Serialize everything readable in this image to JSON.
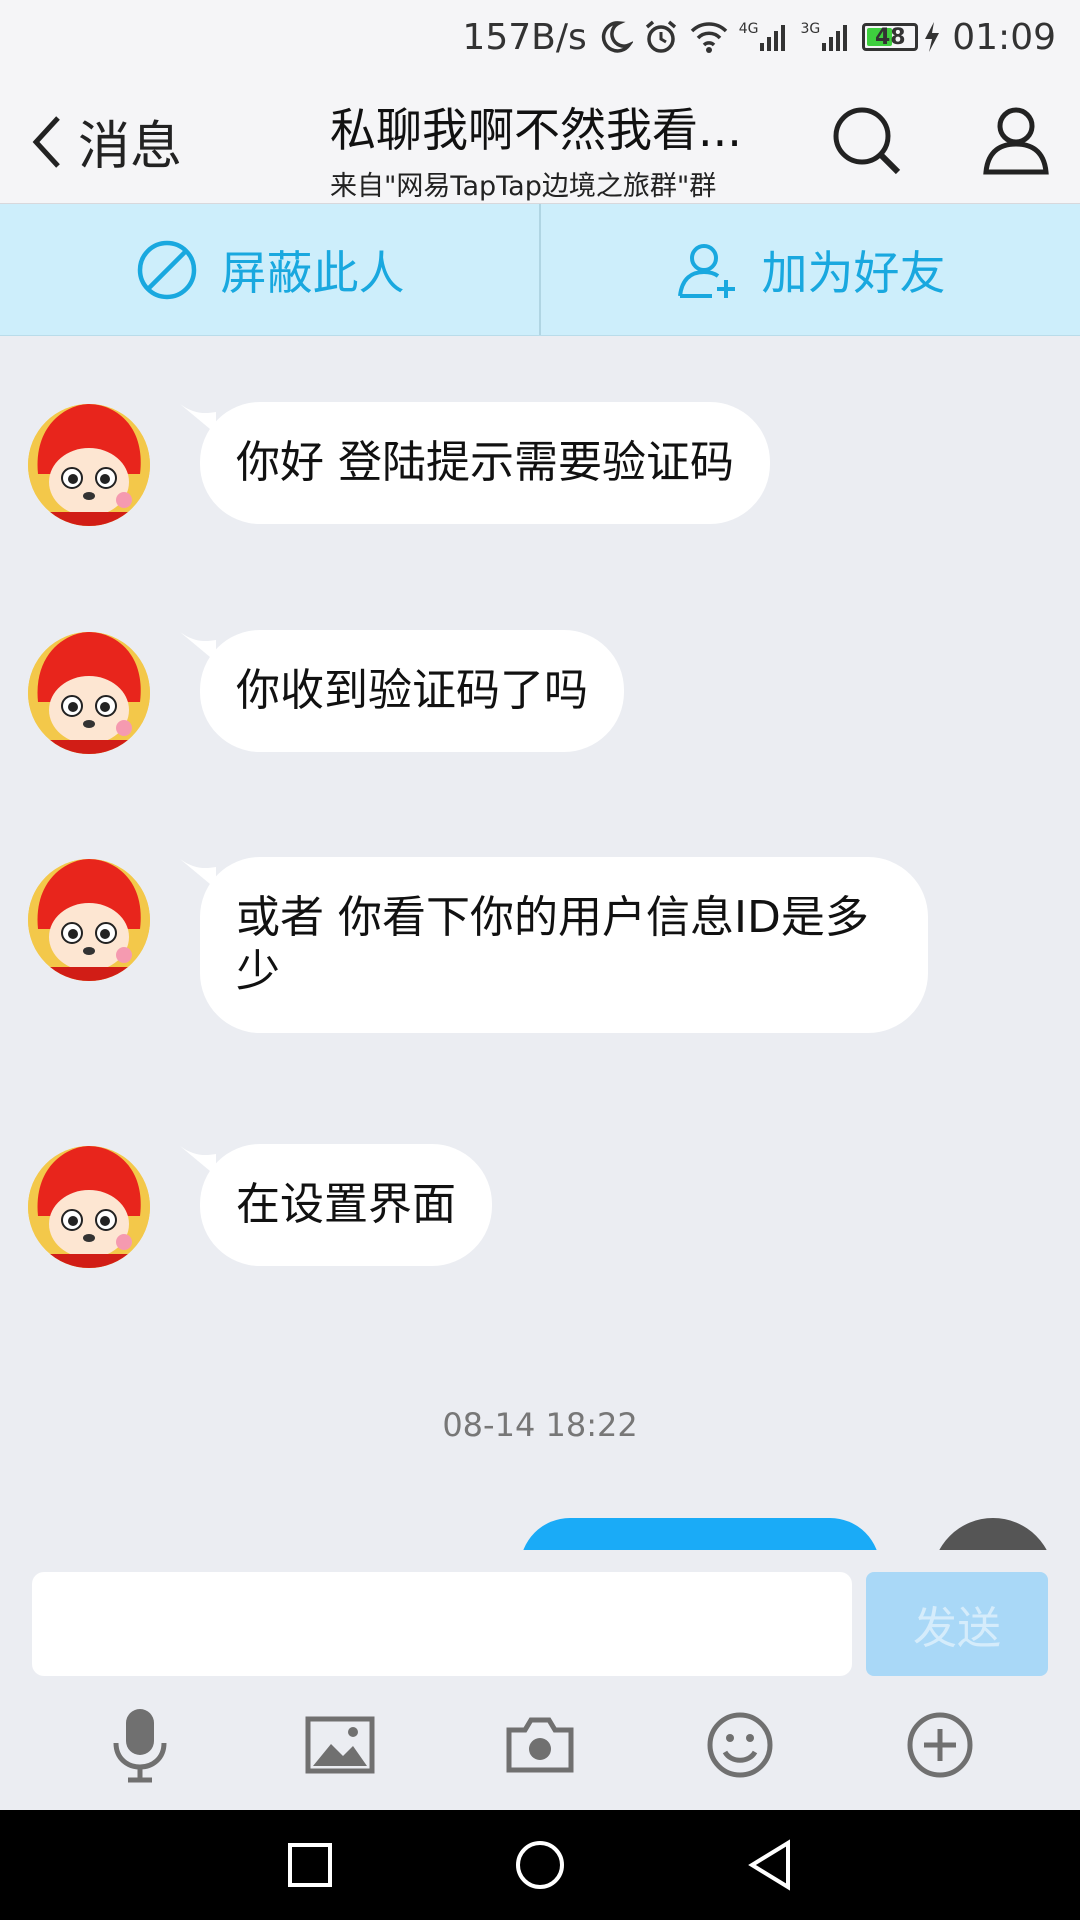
{
  "status": {
    "speed": "157B/s",
    "net1": "4G",
    "net2": "3G",
    "battery": "48",
    "time": "01:09"
  },
  "nav": {
    "back_label": "消息",
    "title": "私聊我啊不然我看...",
    "subtitle": "来自\"网易TapTap边境之旅群\"群"
  },
  "actions": {
    "block_label": "屏蔽此人",
    "add_friend_label": "加为好友"
  },
  "messages": [
    {
      "text": "你好 登陆提示需要验证码"
    },
    {
      "text": "你收到验证码了吗"
    },
    {
      "text": "或者 你看下你的用户信息ID是多少"
    },
    {
      "text": "在设置界面"
    }
  ],
  "timestamp": "08-14 18:22",
  "input": {
    "placeholder": "",
    "send_label": "发送"
  },
  "toolbar_icons": [
    "microphone-icon",
    "image-icon",
    "camera-icon",
    "emoji-icon",
    "plus-icon"
  ],
  "colors": {
    "accent": "#19a8df",
    "outgoing_bubble": "#1aabf7",
    "send_button": "#a9d8f7"
  }
}
